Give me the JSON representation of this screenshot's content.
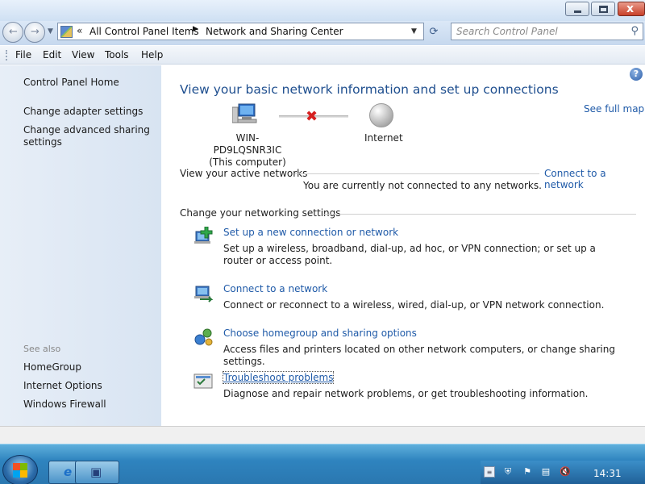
{
  "window": {
    "close_glyph": "x"
  },
  "address": {
    "chevron": "«",
    "crumbs": [
      "All Control Panel Items",
      "Network and Sharing Center"
    ],
    "separator": "▶"
  },
  "search": {
    "placeholder": "Search Control Panel"
  },
  "menu": {
    "items": [
      "File",
      "Edit",
      "View",
      "Tools",
      "Help"
    ]
  },
  "sidebar": {
    "home": "Control Panel Home",
    "links": [
      "Change adapter settings",
      "Change advanced sharing settings"
    ],
    "see_also_heading": "See also",
    "see_also": [
      "HomeGroup",
      "Internet Options",
      "Windows Firewall"
    ]
  },
  "main": {
    "title": "View your basic network information and set up connections",
    "see_full_map": "See full map",
    "computer_name": "WIN-PD9LQSNR3IC",
    "computer_caption": "(This computer)",
    "internet_label": "Internet",
    "active_networks_heading": "View your active networks",
    "connect_to_network_link": "Connect to a network",
    "not_connected_message": "You are currently not connected to any networks.",
    "change_settings_heading": "Change your networking settings",
    "tasks": [
      {
        "title": "Set up a new connection or network",
        "description": "Set up a wireless, broadband, dial-up, ad hoc, or VPN connection; or set up a router or access point."
      },
      {
        "title": "Connect to a network",
        "description": "Connect or reconnect to a wireless, wired, dial-up, or VPN network connection."
      },
      {
        "title": "Choose homegroup and sharing options",
        "description": "Access files and printers located on other network computers, or change sharing settings."
      },
      {
        "title": "Troubleshoot problems",
        "description": "Diagnose and repair network problems, or get troubleshooting information."
      }
    ]
  },
  "taskbar": {
    "clock": "14:31"
  },
  "colors": {
    "link": "#1f5aa8",
    "title": "#1f4f8f",
    "disconnected_x": "#d62020"
  }
}
